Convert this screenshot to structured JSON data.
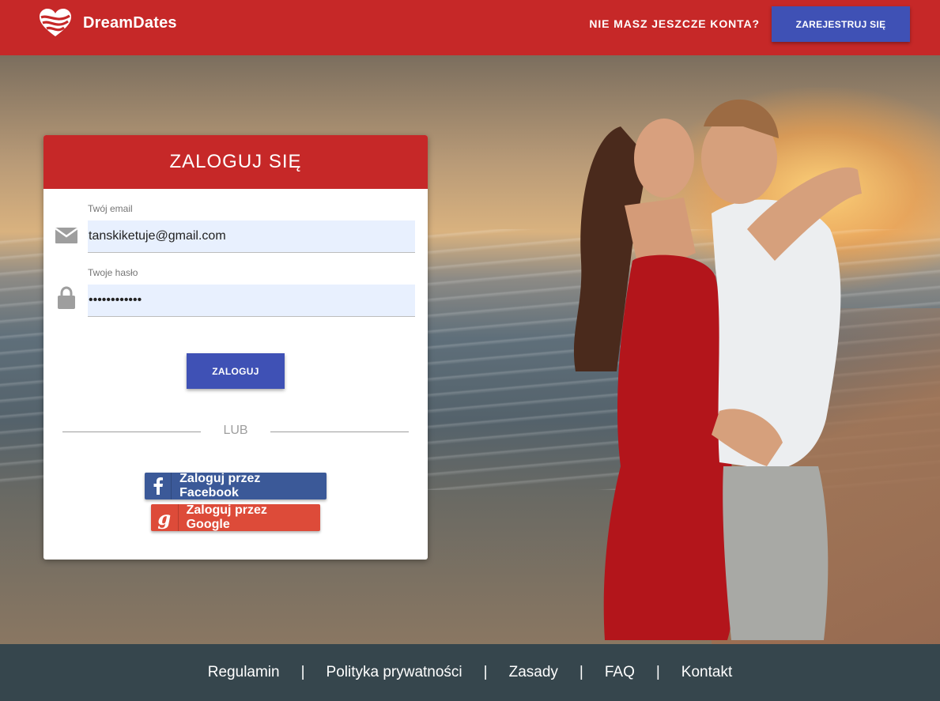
{
  "header": {
    "logo_text": "DreamDates",
    "no_account_text": "NIE MASZ JESZCZE KONTA?",
    "register_button": "ZAREJESTRUJ SIĘ",
    "brand_color": "#c62828",
    "button_color": "#3f51b5"
  },
  "login": {
    "title": "ZALOGUJ SIĘ",
    "email_label": "Twój email",
    "email_value": "tanskiketuje@gmail.com",
    "password_label": "Twoje hasło",
    "password_value": "••••••••••••",
    "submit_label": "ZALOGUJ",
    "or_text": "LUB",
    "facebook_label": "Zaloguj przez Facebook",
    "google_label": "Zaloguj przez Google",
    "facebook_color": "#3b5998",
    "google_color": "#dd4b39"
  },
  "icons": {
    "logo": "heart-stripes-icon",
    "email": "envelope-icon",
    "password": "lock-icon",
    "facebook": "facebook-icon",
    "google": "google-icon"
  },
  "footer": {
    "links": [
      "Regulamin",
      "Polityka prywatności",
      "Zasady",
      "FAQ",
      "Kontakt"
    ],
    "separator": "|",
    "background": "#36464d"
  }
}
